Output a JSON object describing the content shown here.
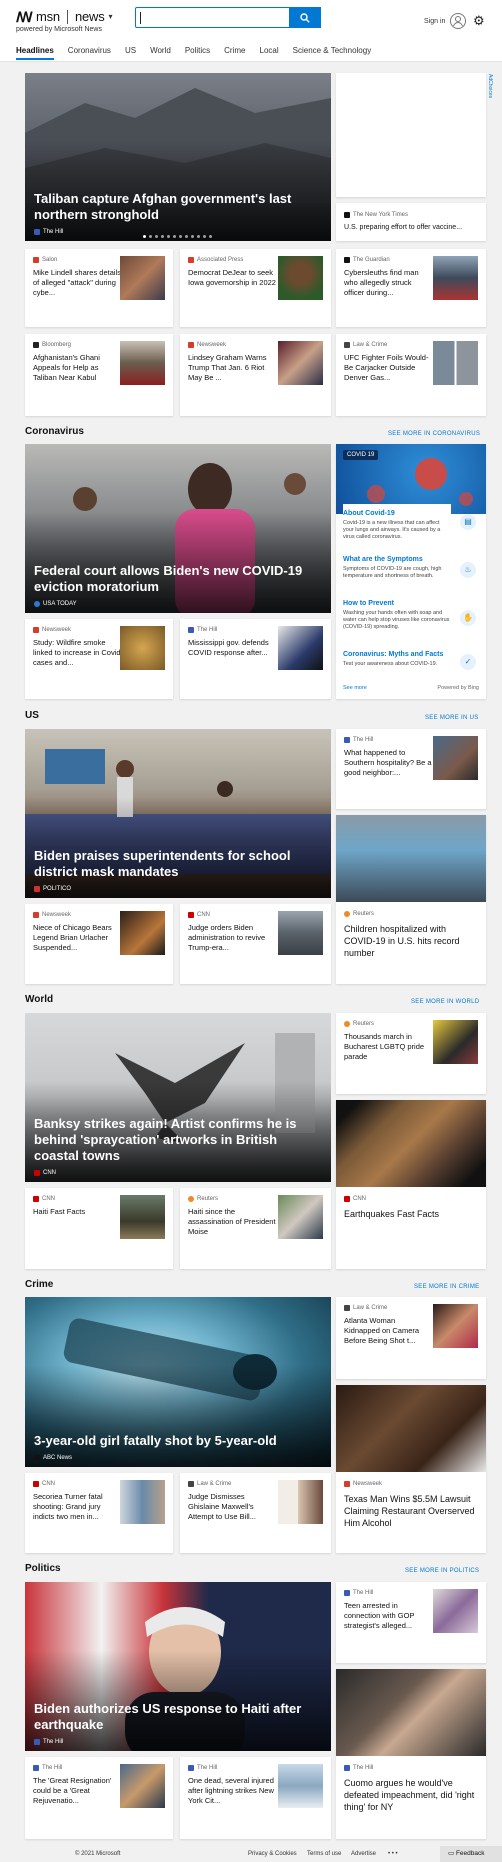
{
  "header": {
    "brand_msn": "msn",
    "brand_news": "news",
    "powered_by": "powered by Microsoft News",
    "search_placeholder": "",
    "sign_in": "Sign in",
    "tabs": [
      "Headlines",
      "Coronavirus",
      "US",
      "World",
      "Politics",
      "Crime",
      "Local",
      "Science & Technology"
    ]
  },
  "adchoices": "AdChoices",
  "headlines": {
    "hero": {
      "title": "Taliban capture Afghan government's last northern stronghold",
      "source": "The Hill"
    },
    "side_top_1": {
      "source": "The New York Times",
      "title": "U.S. preparing effort to offer vaccine..."
    },
    "row1": [
      {
        "source": "Salon",
        "title": "Mike Lindell shares details of alleged \"attack\" during cybe..."
      },
      {
        "source": "Associated Press",
        "title": "Democrat DeJear to seek Iowa governorship in 2022"
      },
      {
        "source": "The Guardian",
        "title": "Cybersleuths find man who allegedly struck officer during..."
      }
    ],
    "row2": [
      {
        "source": "Bloomberg",
        "title": "Afghanistan's Ghani Appeals for Help as Taliban Near Kabul"
      },
      {
        "source": "Newsweek",
        "title": "Lindsey Graham Warns Trump That Jan. 6 Riot May Be ..."
      },
      {
        "source": "Law & Crime",
        "title": "UFC Fighter Foils Would-Be Carjacker Outside Denver Gas..."
      }
    ]
  },
  "coronavirus": {
    "heading": "Coronavirus",
    "see_more": "SEE MORE IN CORONAVIRUS",
    "hero": {
      "title": "Federal court allows Biden's new COVID-19 eviction moratorium",
      "source": "USA TODAY"
    },
    "row": [
      {
        "source": "Newsweek",
        "title": "Study: Wildfire smoke linked to increase in Covid cases and..."
      },
      {
        "source": "The Hill",
        "title": "Mississippi gov. defends COVID response after..."
      }
    ],
    "widget": {
      "pill": "COVID 19",
      "items": [
        {
          "title": "About Covid-19",
          "desc": "Covid-19 is a new illness that can affect your lungs and airways. It's caused by a virus called coronavirus."
        },
        {
          "title": "What are the Symptoms",
          "desc": "Symptoms of COVID-19 are cough, high temperature and shortness of breath."
        },
        {
          "title": "How to Prevent",
          "desc": "Washing your hands often with soap and water can help stop viruses like coronavirus (COVID-19) spreading."
        },
        {
          "title": "Coronavirus: Myths and Facts",
          "desc": "Test your awareness about COVID-19."
        }
      ],
      "see_more": "See more",
      "powered": "Powered by Bing"
    }
  },
  "us": {
    "heading": "US",
    "see_more": "SEE MORE IN US",
    "hero": {
      "title": "Biden praises superintendents for school district mask mandates",
      "source": "POLITICO"
    },
    "side_small": {
      "source": "The Hill",
      "title": "What happened to Southern hospitality? Be a good neighbor:..."
    },
    "side_tall": {
      "source": "Reuters",
      "title": "Children hospitalized with COVID-19 in U.S. hits record number"
    },
    "row": [
      {
        "source": "Newsweek",
        "title": "Niece of Chicago Bears Legend Brian Urlacher Suspended..."
      },
      {
        "source": "CNN",
        "title": "Judge orders Biden administration to revive Trump-era..."
      }
    ]
  },
  "world": {
    "heading": "World",
    "see_more": "SEE MORE IN WORLD",
    "hero": {
      "title": "Banksy strikes again! Artist confirms he is behind 'spraycation' artworks in British coastal towns",
      "source": "CNN"
    },
    "side_small": {
      "source": "Reuters",
      "title": "Thousands march in Bucharest LGBTQ pride parade"
    },
    "side_tall": {
      "source": "CNN",
      "title": "Earthquakes Fast Facts"
    },
    "row": [
      {
        "source": "CNN",
        "title": "Haiti Fast Facts"
      },
      {
        "source": "Reuters",
        "title": "Haiti since the assassination of President Moise"
      }
    ]
  },
  "crime": {
    "heading": "Crime",
    "see_more": "SEE MORE IN CRIME",
    "hero": {
      "title": "3-year-old girl fatally shot by 5-year-old",
      "source": "ABC News"
    },
    "side_small": {
      "source": "Law & Crime",
      "title": "Atlanta Woman Kidnapped on Camera Before Being Shot t..."
    },
    "side_tall": {
      "source": "Newsweek",
      "title": "Texas Man Wins $5.5M Lawsuit Claiming Restaurant Overserved Him Alcohol"
    },
    "row": [
      {
        "source": "CNN",
        "title": "Secoriea Turner fatal shooting: Grand jury indicts two men in..."
      },
      {
        "source": "Law & Crime",
        "title": "Judge Dismisses Ghislaine Maxwell's Attempt to Use Bill..."
      }
    ]
  },
  "politics": {
    "heading": "Politics",
    "see_more": "SEE MORE IN POLITICS",
    "hero": {
      "title": "Biden authorizes US response to Haiti after earthquake",
      "source": "The Hill"
    },
    "side_small": {
      "source": "The Hill",
      "title": "Teen arrested in connection with GOP strategist's alleged..."
    },
    "side_tall": {
      "source": "The Hill",
      "title": "Cuomo argues he would've defeated impeachment, did 'right thing' for NY"
    },
    "row": [
      {
        "source": "The Hill",
        "title": "The 'Great Resignation' could be a 'Great Rejuvenatio..."
      },
      {
        "source": "The Hill",
        "title": "One dead, several injured after lightning strikes New York Cit..."
      }
    ]
  },
  "footer": {
    "copyright": "© 2021 Microsoft",
    "privacy": "Privacy & Cookies",
    "terms": "Terms of use",
    "advertise": "Advertise",
    "more": "• • •",
    "feedback": "Feedback"
  },
  "colors": {
    "accent": "#0078d4",
    "page_bg": "#f1f1f1"
  }
}
